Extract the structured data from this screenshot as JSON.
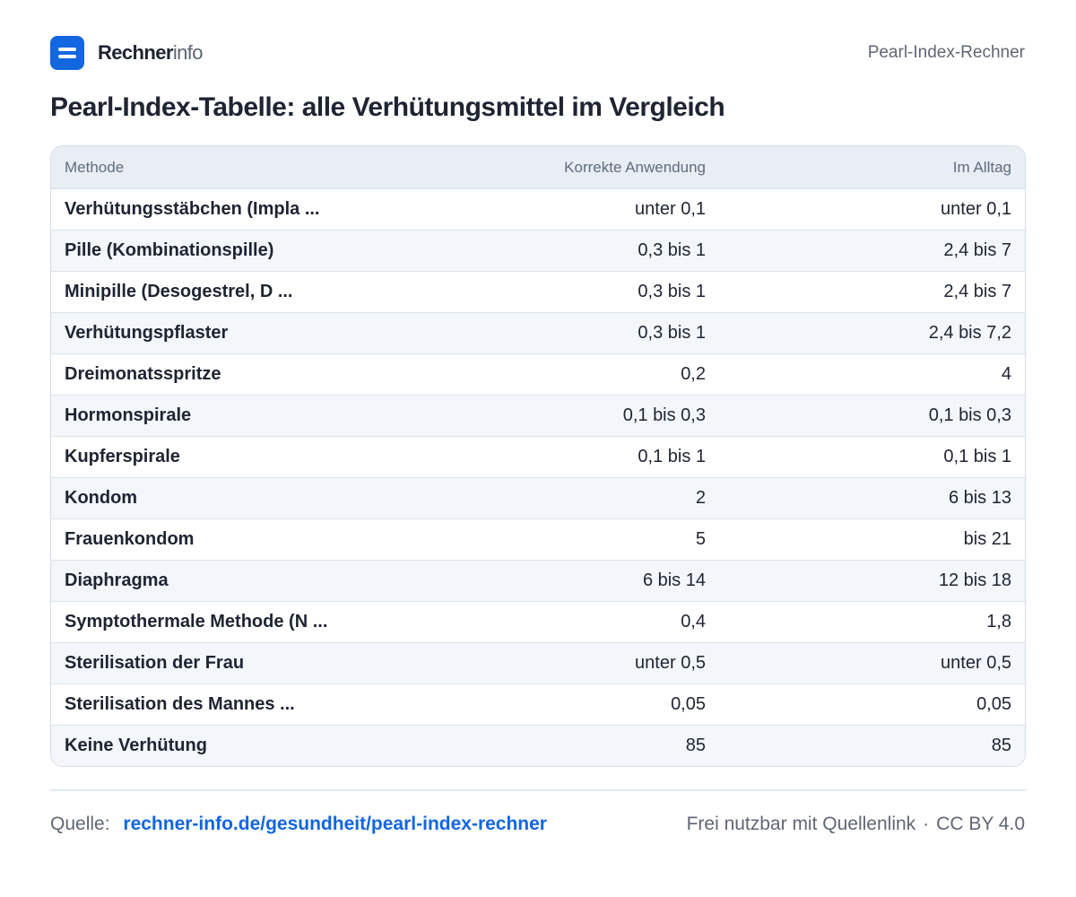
{
  "header": {
    "brand_bold": "Rechner",
    "brand_light": "info",
    "tool_name": "Pearl-Index-Rechner",
    "logo_icon": "rechner-logo-icon",
    "accent_color": "#1266e0"
  },
  "title": "Pearl-Index-Tabelle: alle Verhütungsmittel im Vergleich",
  "table": {
    "columns": [
      "Methode",
      "Korrekte Anwendung",
      "Im Alltag"
    ],
    "rows": [
      {
        "method": "Verhütungsstäbchen (Impla ...",
        "correct": "unter 0,1",
        "daily": "unter 0,1"
      },
      {
        "method": "Pille (Kombinationspille)",
        "correct": "0,3 bis 1",
        "daily": "2,4 bis 7"
      },
      {
        "method": "Minipille (Desogestrel, D ...",
        "correct": "0,3 bis 1",
        "daily": "2,4 bis 7"
      },
      {
        "method": "Verhütungspflaster",
        "correct": "0,3 bis 1",
        "daily": "2,4 bis 7,2"
      },
      {
        "method": "Dreimonatsspritze",
        "correct": "0,2",
        "daily": "4"
      },
      {
        "method": "Hormonspirale",
        "correct": "0,1 bis 0,3",
        "daily": "0,1 bis 0,3"
      },
      {
        "method": "Kupferspirale",
        "correct": "0,1 bis 1",
        "daily": "0,1 bis 1"
      },
      {
        "method": "Kondom",
        "correct": "2",
        "daily": "6 bis 13"
      },
      {
        "method": "Frauenkondom",
        "correct": "5",
        "daily": "bis 21"
      },
      {
        "method": "Diaphragma",
        "correct": "6 bis 14",
        "daily": "12 bis 18"
      },
      {
        "method": "Symptothermale Methode (N ...",
        "correct": "0,4",
        "daily": "1,8"
      },
      {
        "method": "Sterilisation der Frau",
        "correct": "unter 0,5",
        "daily": "unter 0,5"
      },
      {
        "method": "Sterilisation des Mannes ...",
        "correct": "0,05",
        "daily": "0,05"
      },
      {
        "method": "Keine Verhütung",
        "correct": "85",
        "daily": "85"
      }
    ]
  },
  "footer": {
    "source_label": "Quelle:",
    "source_link": "rechner-info.de/gesundheit/pearl-index-rechner",
    "license_text": "Frei nutzbar mit Quellenlink",
    "separator": "·",
    "license": "CC BY 4.0"
  }
}
